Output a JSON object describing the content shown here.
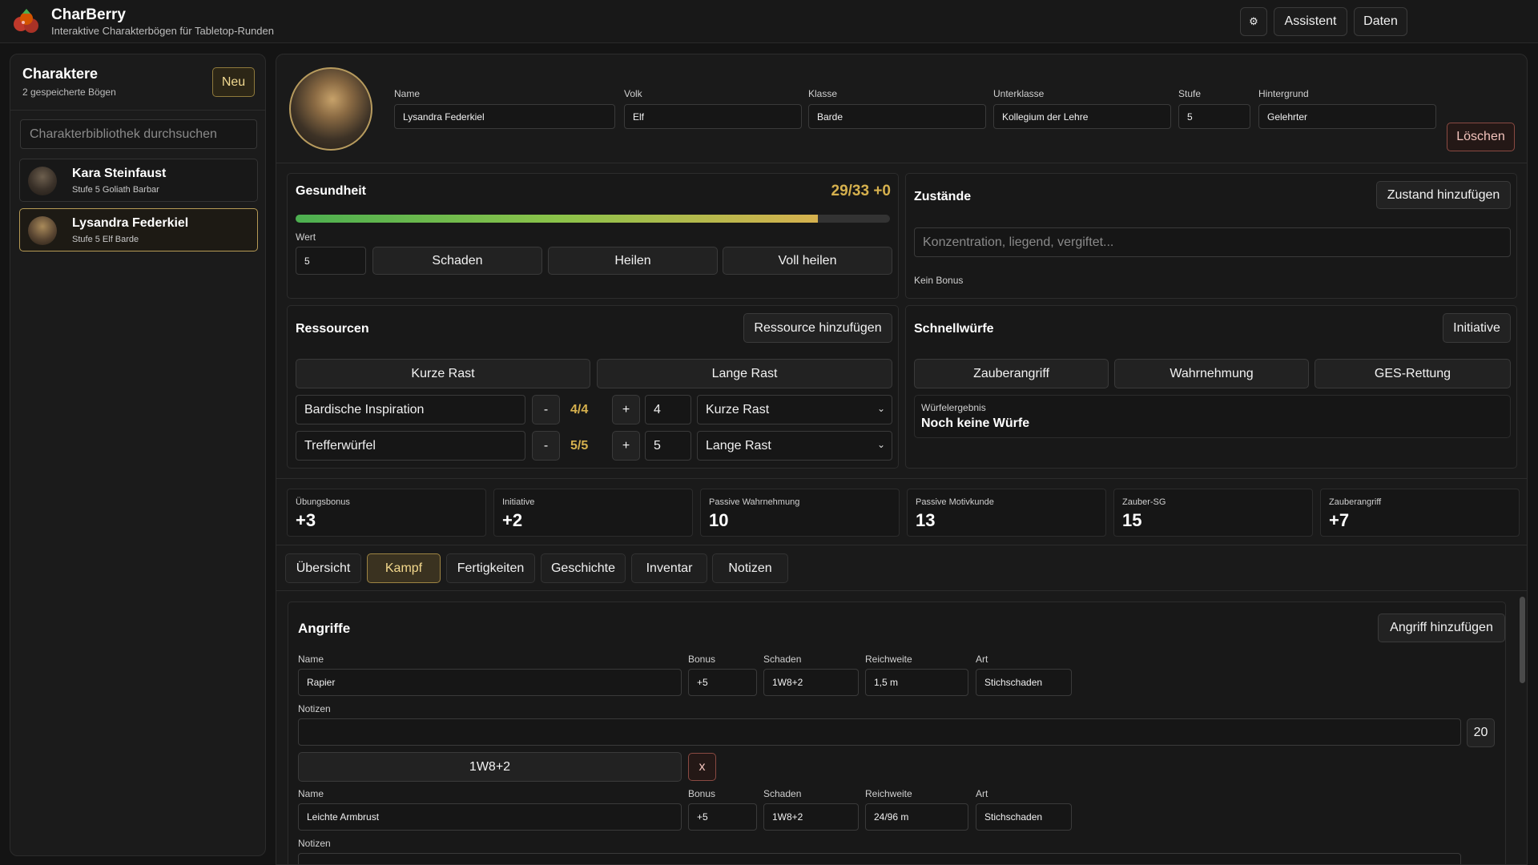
{
  "app": {
    "title": "CharBerry",
    "subtitle": "Interaktive Charakterbögen für Tabletop-Runden"
  },
  "topbar": {
    "settings_icon": "⚙",
    "assistant_label": "Assistent",
    "data_label": "Daten"
  },
  "sidebar": {
    "title": "Charaktere",
    "count": "2 gespeicherte Bögen",
    "new_label": "Neu",
    "search_placeholder": "Charakterbibliothek durchsuchen",
    "characters": [
      {
        "name": "Kara Steinfaust",
        "meta": "Stufe 5 Goliath Barbar"
      },
      {
        "name": "Lysandra Federkiel",
        "meta": "Stufe 5 Elf Barde"
      }
    ]
  },
  "header": {
    "fields": [
      {
        "label": "Name",
        "value": "Lysandra Federkiel"
      },
      {
        "label": "Volk",
        "value": "Elf"
      },
      {
        "label": "Klasse",
        "value": "Barde"
      },
      {
        "label": "Unterklasse",
        "value": "Kollegium der Lehre"
      },
      {
        "label": "Stufe",
        "value": "5"
      },
      {
        "label": "Hintergrund",
        "value": "Gelehrter"
      }
    ],
    "delete_label": "Löschen"
  },
  "health": {
    "title": "Gesundheit",
    "display": "29/33 +0",
    "current": 29,
    "max": 33,
    "value_label": "Wert",
    "value": "5",
    "damage_label": "Schaden",
    "heal_label": "Heilen",
    "full_heal_label": "Voll heilen"
  },
  "conditions": {
    "title": "Zustände",
    "add_label": "Zustand hinzufügen",
    "placeholder": "Konzentration, liegend, vergiftet...",
    "bonus_text": "Kein Bonus"
  },
  "resources": {
    "title": "Ressourcen",
    "add_label": "Ressource hinzufügen",
    "short_rest_label": "Kurze Rast",
    "long_rest_label": "Lange Rast",
    "items": [
      {
        "name": "Bardische Inspiration",
        "minus": "-",
        "count": "4/4",
        "plus": "+",
        "max": "4",
        "reset": "Kurze Rast"
      },
      {
        "name": "Trefferwürfel",
        "minus": "-",
        "count": "5/5",
        "plus": "+",
        "max": "5",
        "reset": "Lange Rast"
      }
    ]
  },
  "quickrolls": {
    "title": "Schnellwürfe",
    "initiative_label": "Initiative",
    "buttons": [
      "Zauberangriff",
      "Wahrnehmung",
      "GES-Rettung"
    ],
    "result_label": "Würfelergebnis",
    "result_value": "Noch keine Würfe"
  },
  "stats": [
    {
      "label": "Übungsbonus",
      "value": "+3"
    },
    {
      "label": "Initiative",
      "value": "+2"
    },
    {
      "label": "Passive Wahrnehmung",
      "value": "10"
    },
    {
      "label": "Passive Motivkunde",
      "value": "13"
    },
    {
      "label": "Zauber-SG",
      "value": "15"
    },
    {
      "label": "Zauberangriff",
      "value": "+7"
    }
  ],
  "tabs": [
    "Übersicht",
    "Kampf",
    "Fertigkeiten",
    "Geschichte",
    "Inventar",
    "Notizen"
  ],
  "active_tab": "Kampf",
  "attacks": {
    "title": "Angriffe",
    "add_label": "Angriff hinzufügen",
    "col_labels": {
      "name": "Name",
      "bonus": "Bonus",
      "damage": "Schaden",
      "range": "Reichweite",
      "type": "Art",
      "notes": "Notizen"
    },
    "items": [
      {
        "name": "Rapier",
        "bonus": "+5",
        "damage": "1W8+2",
        "range": "1,5 m",
        "type": "Stichschaden",
        "notes": "",
        "roll": "20",
        "damage_roll": "1W8+2",
        "remove": "x"
      },
      {
        "name": "Leichte Armbrust",
        "bonus": "+5",
        "damage": "1W8+2",
        "range": "24/96 m",
        "type": "Stichschaden",
        "notes": ""
      }
    ]
  },
  "colors": {
    "accent": "#d6b14e",
    "background": "#141414",
    "panel": "#181818",
    "danger": "#8a4a42",
    "hp_green": "#4caf50"
  }
}
